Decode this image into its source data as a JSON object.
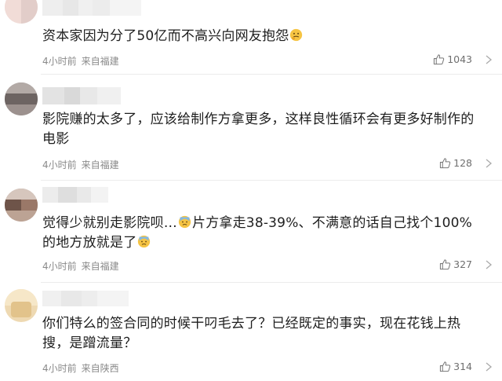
{
  "comments": [
    {
      "text": "资本家因为分了50亿而不高兴向网友抱怨",
      "emoji": "thinking-face",
      "time": "4小时前",
      "location": "来自福建",
      "likes": "1043"
    },
    {
      "text": "影院赚的太多了，应该给制作方拿更多，这样良性循环会有更多好制作的电影",
      "time": "4小时前",
      "location": "来自福建",
      "likes": "128"
    },
    {
      "text_before": "觉得少就别走影院呗…",
      "emoji": "cold-sweat-face",
      "text_after": "片方拿走38-39%、不满意的话自己找个100%的地方放就是了",
      "emoji_end": "cold-sweat-face",
      "time": "4小时前",
      "location": "来自福建",
      "likes": "327"
    },
    {
      "text": "你们特么的签合同的时候干叼毛去了？已经既定的事实，现在花钱上热搜，是蹭流量？",
      "time": "4小时前",
      "location": "来自陕西",
      "likes": "314"
    }
  ]
}
